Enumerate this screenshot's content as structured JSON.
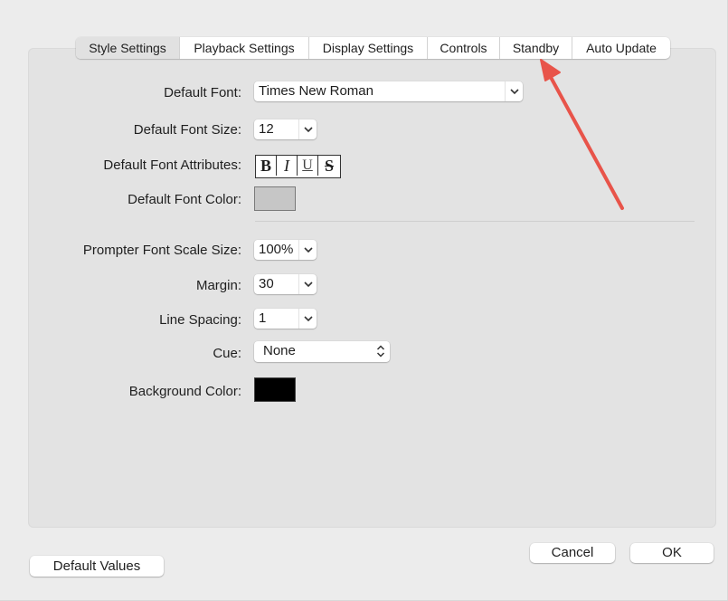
{
  "tabs": [
    "Style Settings",
    "Playback Settings",
    "Display Settings",
    "Controls",
    "Standby",
    "Auto Update"
  ],
  "labels": {
    "default_font": "Default Font:",
    "default_font_size": "Default Font Size:",
    "default_font_attributes": "Default Font Attributes:",
    "default_font_color": "Default Font Color:",
    "prompter_font_scale": "Prompter Font Scale Size:",
    "margin": "Margin:",
    "line_spacing": "Line Spacing:",
    "cue": "Cue:",
    "background_color": "Background Color:"
  },
  "values": {
    "default_font": "Times New Roman",
    "default_font_size": "12",
    "prompter_font_scale": "100%",
    "margin": "30",
    "line_spacing": "1",
    "cue": "None"
  },
  "font_attributes": [
    "B",
    "I",
    "U",
    "S"
  ],
  "colors": {
    "default_font_color": "#c6c6c6",
    "background_color": "#000000",
    "annotation_arrow": "#e8544a"
  },
  "buttons": {
    "default_values": "Default Values",
    "cancel": "Cancel",
    "ok": "OK"
  }
}
